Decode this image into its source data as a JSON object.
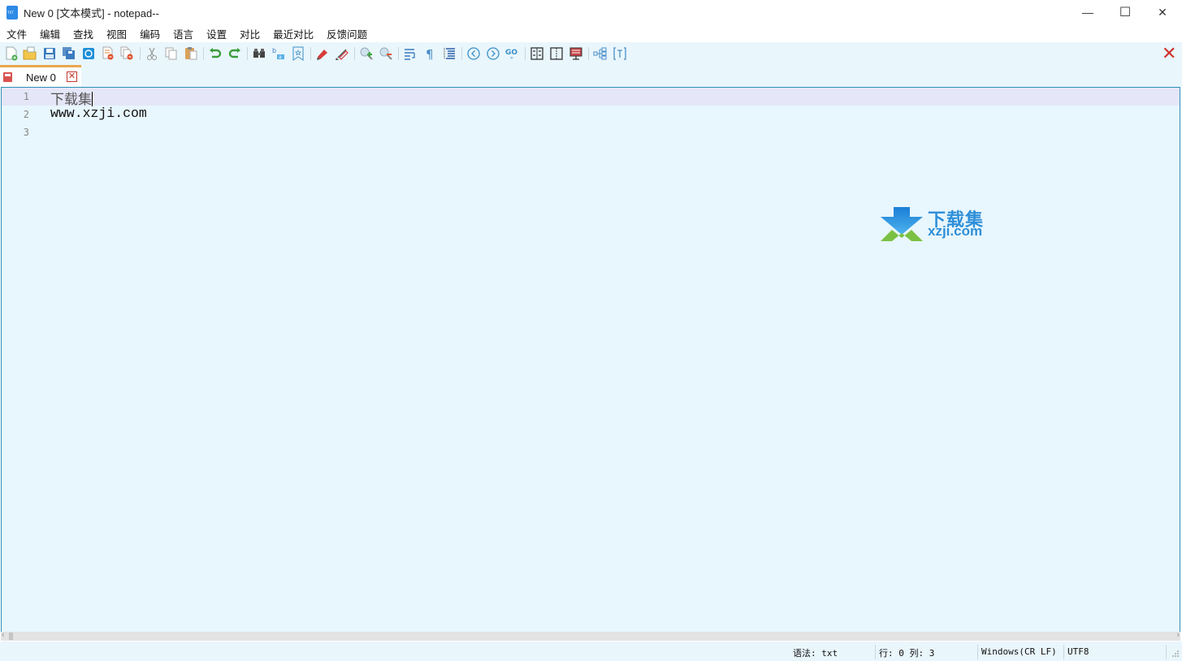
{
  "window": {
    "title": "New 0 [文本模式] - notepad--",
    "minimize_glyph": "—",
    "maximize_glyph": "☐",
    "close_glyph": "✕"
  },
  "menu": {
    "items": [
      "文件",
      "编辑",
      "查找",
      "视图",
      "编码",
      "语言",
      "设置",
      "对比",
      "最近对比",
      "反馈问题"
    ]
  },
  "toolbar": {
    "icons": [
      "new-file-icon",
      "open-folder-icon",
      "save-icon",
      "save-all-icon",
      "autosave-icon",
      "close-file-icon",
      "close-all-icon",
      "cut-icon",
      "copy-icon",
      "paste-icon",
      "undo-icon",
      "redo-icon",
      "find-icon",
      "replace-icon",
      "bookmark-icon",
      "mark-icon",
      "clear-mark-icon",
      "zoom-in-icon",
      "zoom-out-icon",
      "word-wrap-icon",
      "show-symbols-icon",
      "indent-guide-icon",
      "prev-icon",
      "next-icon",
      "goto-icon",
      "compare-files-icon",
      "compare-dirs-icon",
      "bin-compare-icon",
      "tree-view-icon",
      "text-mode-icon"
    ],
    "close_all_glyph": "✕"
  },
  "tabs": [
    {
      "label": "New 0",
      "close_glyph": "✕",
      "active": true
    }
  ],
  "editor": {
    "lines": [
      {
        "number": "1",
        "text": "下载集"
      },
      {
        "number": "2",
        "text": "www.xzji.com"
      },
      {
        "number": "3",
        "text": ""
      }
    ],
    "current_line": 1
  },
  "watermark": {
    "title": "下载集",
    "url": "xzji.com"
  },
  "status": {
    "syntax": "语法: txt",
    "position": "行: 0 列: 3",
    "eol": "Windows(CR LF)",
    "encoding": "UTF8"
  }
}
